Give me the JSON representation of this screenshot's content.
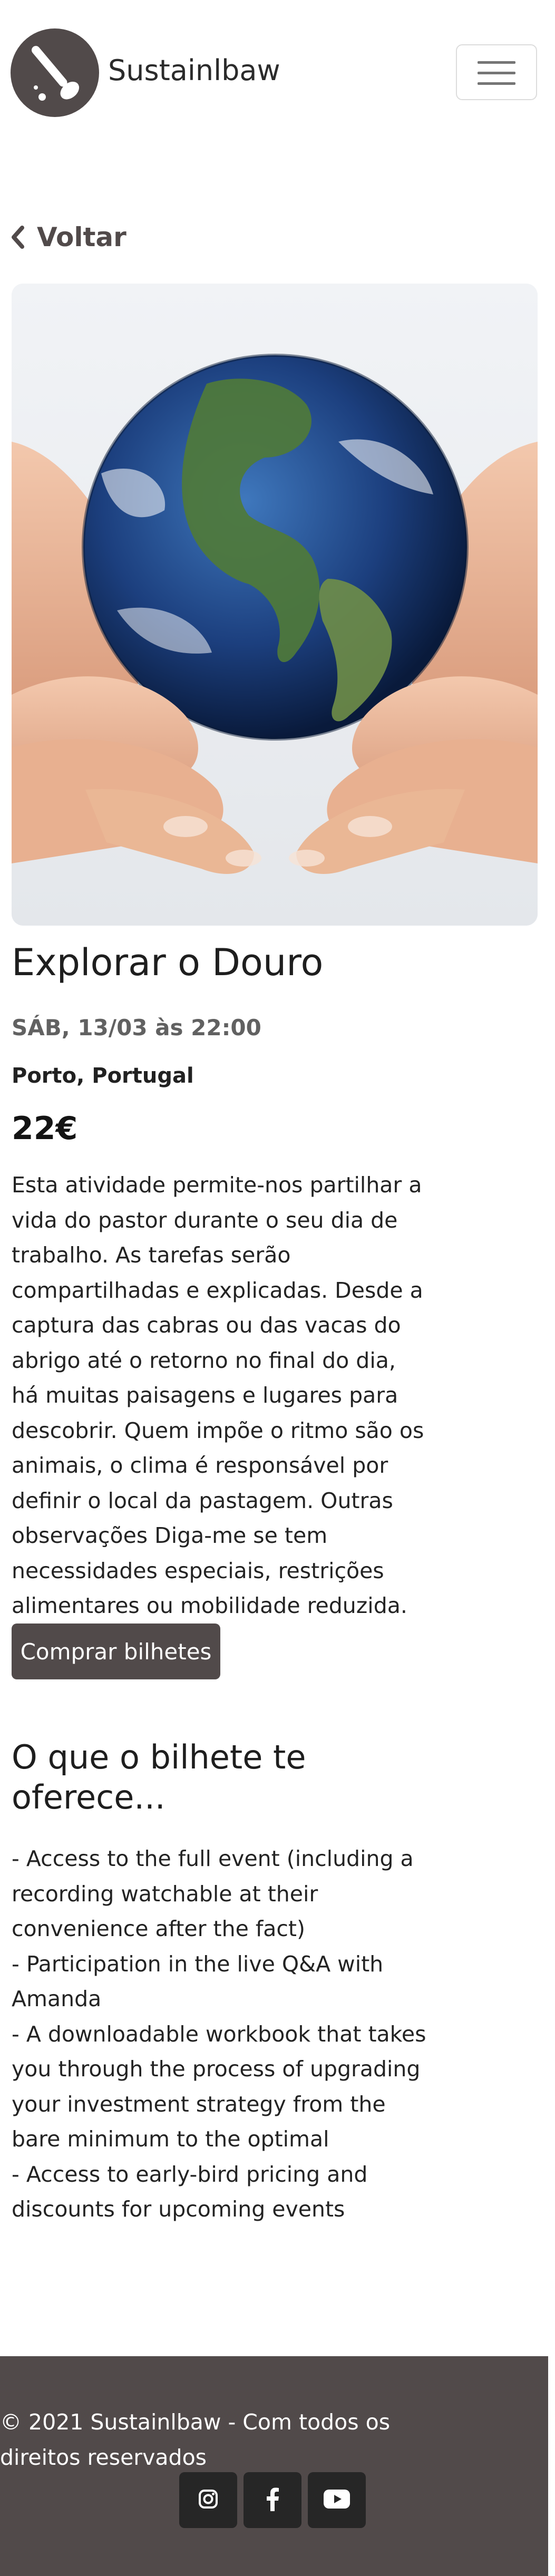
{
  "header": {
    "brand": "Sustainlbaw",
    "menu_icon": "hamburger-menu-icon",
    "logo_icon": "spoon-logo-icon"
  },
  "nav": {
    "back_label": "Voltar",
    "back_icon": "chevron-left-icon"
  },
  "event": {
    "image_alt": "Globe held in two hands",
    "title": "Explorar o Douro",
    "date": "SÁB, 13/03 às 22:00",
    "location": "Porto, Portugal",
    "price": "22€",
    "description": "Esta atividade permite-nos partilhar a vida do pastor durante o seu dia de trabalho. As tarefas serão compartilhadas e explicadas. Desde a captura das cabras ou das vacas do abrigo até o retorno no final do dia, há muitas paisagens e lugares para descobrir. Quem impõe o ritmo são os animais, o clima é responsável por definir o local da pastagem. Outras observações Diga-me se tem necessidades especiais, restrições alimentares ou mobilidade reduzida.",
    "buy_label": "Comprar bilhetes"
  },
  "offers": {
    "title": "O que o bilhete te oferece...",
    "items": [
      "- Access to the full event (including a recording watchable at their convenience after the fact)",
      "- Participation in the live Q&A with Amanda",
      "- A downloadable workbook that takes you through the process of upgrading your investment strategy from the bare minimum to the optimal",
      "- Access to early-bird pricing and discounts for upcoming events"
    ]
  },
  "footer": {
    "copyright": "© 2021 Sustainlbaw - Com todos os direitos reservados",
    "socials": [
      {
        "name": "instagram-icon"
      },
      {
        "name": "facebook-icon"
      },
      {
        "name": "youtube-icon"
      }
    ]
  },
  "colors": {
    "brand": "#514a4a",
    "social_bg": "#262626",
    "text": "#212121"
  }
}
